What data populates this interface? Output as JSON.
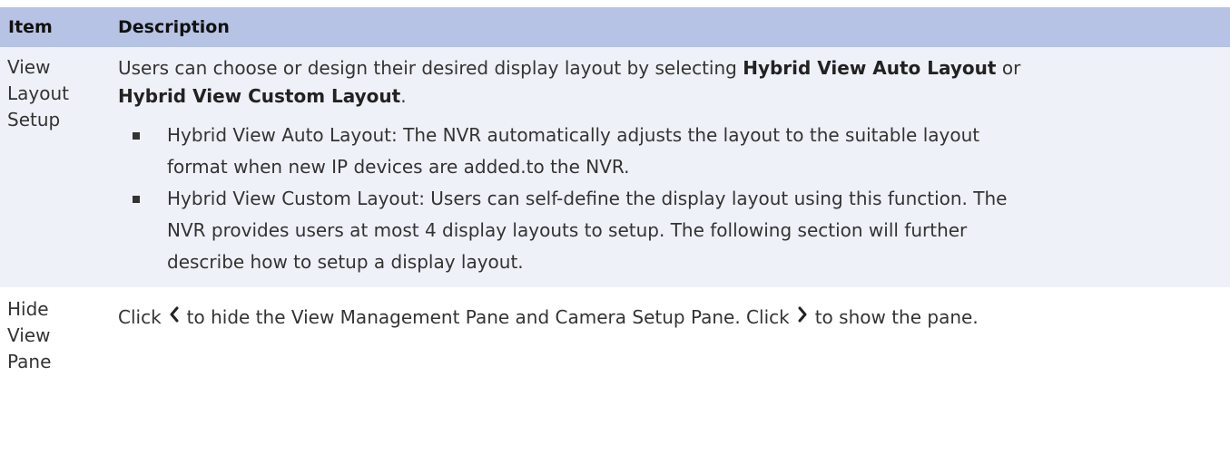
{
  "table": {
    "header": {
      "item": "Item",
      "description": "Description"
    },
    "rows": [
      {
        "item_lines": [
          "View",
          "Layout",
          "Setup"
        ],
        "intro_prefix": "Users can choose or design their desired display layout by selecting ",
        "intro_bold1": "Hybrid View Auto Layout",
        "intro_mid": " or",
        "intro_bold2": "Hybrid View Custom Layout",
        "intro_suffix": ".",
        "bullets": [
          {
            "lines": [
              "Hybrid View Auto Layout: The NVR automatically adjusts the layout to the suitable layout",
              "format when new IP devices are added.to the NVR."
            ]
          },
          {
            "lines": [
              "Hybrid View Custom Layout: Users can self-define the display layout using this function. The",
              "NVR provides users at most 4 display layouts to setup. The following section will further",
              "describe how to setup a display layout."
            ]
          }
        ]
      },
      {
        "item_lines": [
          "Hide",
          "View",
          "Pane"
        ],
        "text_1": "Click",
        "text_2": "to hide the View Management Pane and Camera Setup Pane. Click",
        "text_3": "to show the pane.",
        "icons": [
          "chevron-left-icon",
          "chevron-right-icon"
        ]
      }
    ]
  }
}
